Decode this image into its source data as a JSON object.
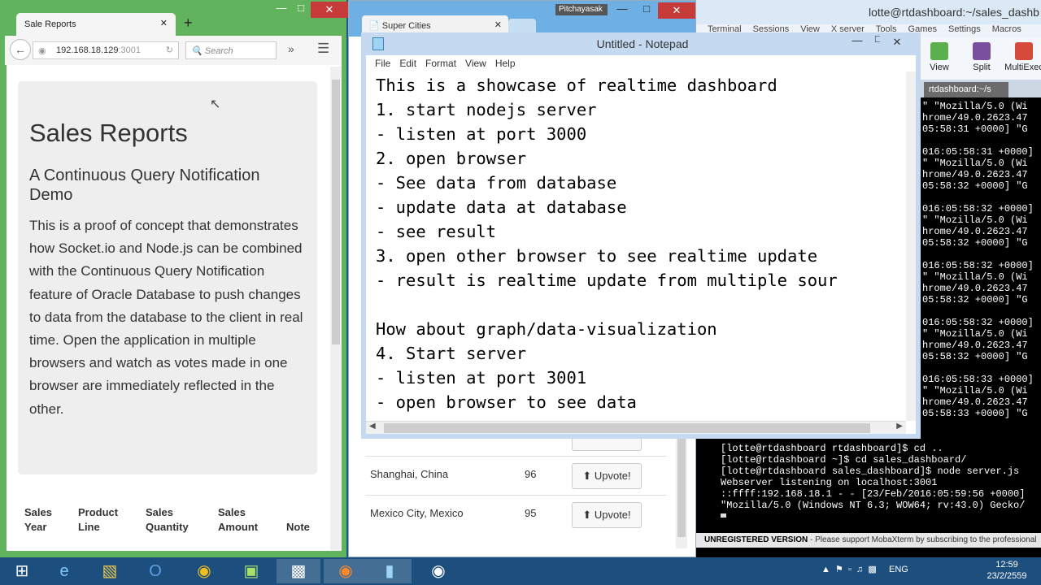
{
  "terminal": {
    "title": "lotte@rtdashboard:~/sales_dashb",
    "menu": [
      "Terminal",
      "Sessions",
      "View",
      "X server",
      "Tools",
      "Games",
      "Settings",
      "Macros"
    ],
    "tools": [
      "View",
      "Split",
      "MultiExec"
    ],
    "tab_label": "rtdashboard:~/s",
    "top_log": "\" \"Mozilla/5.0 (Wi\nhrome/49.0.2623.47\n05:58:31 +0000] \"G\n\n016:05:58:31 +0000]\n\" \"Mozilla/5.0 (Wi\nhrome/49.0.2623.47\n05:58:32 +0000] \"G\n\n016:05:58:32 +0000]\n\" \"Mozilla/5.0 (Wi\nhrome/49.0.2623.47\n05:58:32 +0000] \"G\n\n016:05:58:32 +0000]\n\" \"Mozilla/5.0 (Wi\nhrome/49.0.2623.47\n05:58:32 +0000] \"G\n\n016:05:58:32 +0000]\n\" \"Mozilla/5.0 (Wi\nhrome/49.0.2623.47\n05:58:32 +0000] \"G\n\n016:05:58:33 +0000]\n\" \"Mozilla/5.0 (Wi\nhrome/49.0.2623.47\n05:58:33 +0000] \"G",
    "bottom_log": "[lotte@rtdashboard rtdashboard]$ cd ..\n[lotte@rtdashboard ~]$ cd sales_dashboard/\n[lotte@rtdashboard sales_dashboard]$ node server.js\nWebserver listening on localhost:3001\n::ffff:192.168.18.1 - - [23/Feb/2016:05:59:56 +0000]\n\"Mozilla/5.0 (Windows NT 6.3; WOW64; rv:43.0) Gecko/",
    "status_bold": "UNREGISTERED VERSION",
    "status_text": " - Please support MobaXterm by subscribing to the professional"
  },
  "browser2": {
    "tab_title": "Super Cities",
    "user_badge": "Pitchayasak",
    "rows": [
      {
        "city": "Shanghai, China",
        "votes": "96",
        "button": "Upvote!"
      },
      {
        "city": "Mexico City, Mexico",
        "votes": "95",
        "button": "Upvote!"
      }
    ]
  },
  "notepad": {
    "title": "Untitled - Notepad",
    "menu": [
      "File",
      "Edit",
      "Format",
      "View",
      "Help"
    ],
    "text": "This is a showcase of realtime dashboard\n1. start nodejs server\n- listen at port 3000\n2. open browser\n- See data from database\n- update data at database\n- see result\n3. open other browser to see realtime update\n- result is realtime update from multiple sour\n\nHow about graph/data-visualization\n4. Start server\n- listen at port 3001\n- open browser to see data"
  },
  "firefox": {
    "tab_title": "Sale Reports",
    "url_host": "192.168.18.129",
    "url_port": ":3001",
    "search_placeholder": "Search",
    "heading": "Sales Reports",
    "subheading": "A Continuous Query Notification Demo",
    "paragraph": "This is a proof of concept that demonstrates how Socket.io and Node.js can be combined with the Continuous Query Notification feature of Oracle Database to push changes to data from the database to the client in real time. Open the application in multiple browsers and watch as votes made in one browser are immediately reflected in the other.",
    "columns": [
      "Sales Year",
      "Product Line",
      "Sales Quantity",
      "Sales Amount",
      "Note"
    ]
  },
  "taskbar": {
    "tray_lang": "ENG",
    "time": "12:59",
    "date": "23/2/2559"
  }
}
